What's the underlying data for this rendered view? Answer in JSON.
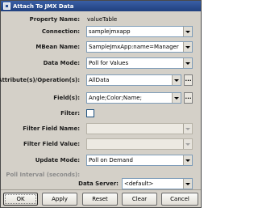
{
  "window": {
    "title": "Attach To JMX Data"
  },
  "form": {
    "property_name": {
      "label": "Property Name:",
      "value": "valueTable"
    },
    "connection": {
      "label": "Connection:",
      "value": "samplejmxapp"
    },
    "mbean_name": {
      "label": "MBean Name:",
      "value": "SampleJmxApp:name=Manager"
    },
    "data_mode": {
      "label": "Data Mode:",
      "value": "Poll for Values"
    },
    "attributes": {
      "label": "Attribute(s)/Operation(s):",
      "value": "AllData",
      "browse_label": "..."
    },
    "fields": {
      "label": "Field(s):",
      "value": "Angle;Color;Name;",
      "browse_label": "..."
    },
    "filter": {
      "label": "Filter:",
      "checked": false
    },
    "filter_field_name": {
      "label": "Filter Field Name:",
      "value": ""
    },
    "filter_field_value": {
      "label": "Filter Field Value:",
      "value": ""
    },
    "update_mode": {
      "label": "Update Mode:",
      "value": "Poll on Demand"
    },
    "poll_interval": {
      "label": "Poll Interval (seconds):",
      "value": ""
    },
    "data_server": {
      "label": "Data Server:",
      "value": "<default>"
    }
  },
  "buttons": {
    "ok": "OK",
    "apply": "Apply",
    "reset": "Reset",
    "clear": "Clear",
    "cancel": "Cancel"
  },
  "colors": {
    "title_bar": "#2a4f95",
    "dialog_bg": "#d4d0c8",
    "field_border": "#7f9db9"
  }
}
